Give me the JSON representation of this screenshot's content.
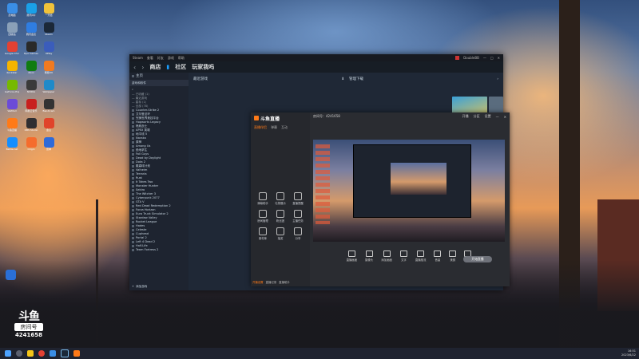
{
  "desktop_icons": [
    {
      "label": "此电脑",
      "color": "#3a8ee6"
    },
    {
      "label": "腾讯QQ",
      "color": "#1aa0e8"
    },
    {
      "label": "一开始",
      "color": "#f0c23a"
    },
    {
      "label": "回收站",
      "color": "#8aa0b8"
    },
    {
      "label": "腾讯会议",
      "color": "#2f7de1"
    },
    {
      "label": "Steam",
      "color": "#1b2838"
    },
    {
      "label": "Google Chrome",
      "color": "#e34133"
    },
    {
      "label": "Epic Games",
      "color": "#2a2a2a"
    },
    {
      "label": "UPlay",
      "color": "#3b5dbb"
    },
    {
      "label": "Rockstar",
      "color": "#f5b400"
    },
    {
      "label": "Xbox",
      "color": "#107c10"
    },
    {
      "label": "网易UU",
      "color": "#f07a20"
    },
    {
      "label": "GeForce Experience",
      "color": "#76b900"
    },
    {
      "label": "NVIDIA",
      "color": "#3a3a3a"
    },
    {
      "label": "Wallpaper",
      "color": "#1f8ac9"
    },
    {
      "label": "WeMod",
      "color": "#6b4bd8"
    },
    {
      "label": "网易云音乐",
      "color": "#c8201e"
    },
    {
      "label": "Bandicam",
      "color": "#333"
    },
    {
      "label": "斗鱼直播",
      "color": "#ff7a18"
    },
    {
      "label": "OBS Studio",
      "color": "#302e31"
    },
    {
      "label": "金山",
      "color": "#e0442a"
    },
    {
      "label": "Battle.net",
      "color": "#148eff"
    },
    {
      "label": "Origin",
      "color": "#f56c2d"
    },
    {
      "label": "雷神",
      "color": "#2e6ad9"
    }
  ],
  "watermark": {
    "logo": "斗鱼",
    "sub": "房间号",
    "room_id": "4241658"
  },
  "steam": {
    "titlebar": {
      "items": [
        "Steam",
        "查看",
        "好友",
        "游戏",
        "帮助"
      ],
      "username": "DoubleBB"
    },
    "nav": {
      "store": "商店",
      "community": "社区",
      "account": "玩家我吗"
    },
    "sidebar": {
      "home": "主页",
      "filter": "游戏和软件",
      "sections": [
        {
          "label": "— 已收藏 (1)"
        },
        {
          "label": "— 最近游戏"
        },
        {
          "label": "— 星标 (1)"
        },
        {
          "label": "— 全部 (78)"
        }
      ],
      "games": [
        "Counter-Strike 2",
        "艾尔登法环",
        "完美世界竞技平台",
        "Hogwarts Legacy",
        "喷射战士",
        "APEX 英雄",
        "地平线 5",
        "Naraka",
        "原神",
        "Among Us",
        "绝地求生",
        "Fall Guys",
        "Dead by Daylight",
        "Dota 2",
        "戴森球计划",
        "Valheim",
        "Terraria",
        "Rust",
        "It Takes Two",
        "Monster Hunter",
        "Sekiro",
        "The Witcher 3",
        "Cyberpunk 2077",
        "GTA V",
        "Red Dead Redemption 2",
        "Forza Horizon",
        "Euro Truck Simulator 2",
        "Stardew Valley",
        "Rocket League",
        "Hades",
        "Celeste",
        "Cuphead",
        "Portal 2",
        "Left 4 Dead 2",
        "Half-Life",
        "Team Fortress 2"
      ],
      "footer": "添加游戏"
    },
    "main": {
      "shelf_title": "最近游戏",
      "downloads": "管理下载",
      "right_label": "Plunder Panic"
    },
    "douyu": {
      "logo": "斗鱼直播",
      "tabs": [
        "直播伴侣",
        "弹幕",
        "互动"
      ],
      "room_label": "房间号：4241658",
      "title_bar_items": [
        "开播",
        "分区",
        "设置"
      ],
      "grid": [
        {
          "label": "弹幕助手"
        },
        {
          "label": "礼物展示"
        },
        {
          "label": "直播提醒"
        },
        {
          "label": "房间管理"
        },
        {
          "label": "粉丝团"
        },
        {
          "label": "主播任务"
        },
        {
          "label": "素材库"
        },
        {
          "label": "抽奖"
        },
        {
          "label": "分享"
        }
      ],
      "toolbar": [
        {
          "label": "直播画面"
        },
        {
          "label": "摄像头"
        },
        {
          "label": "添加画面"
        },
        {
          "label": "文字"
        },
        {
          "label": "直播推流"
        },
        {
          "label": "音量"
        },
        {
          "label": "美颜"
        },
        {
          "label": "设置"
        }
      ],
      "bottom_tabs": [
        "开播设置",
        "直播记录",
        "直播助手"
      ],
      "start_button": "开始直播"
    }
  },
  "taskbar": {
    "time": "16:51",
    "date": "2023/6/22"
  }
}
